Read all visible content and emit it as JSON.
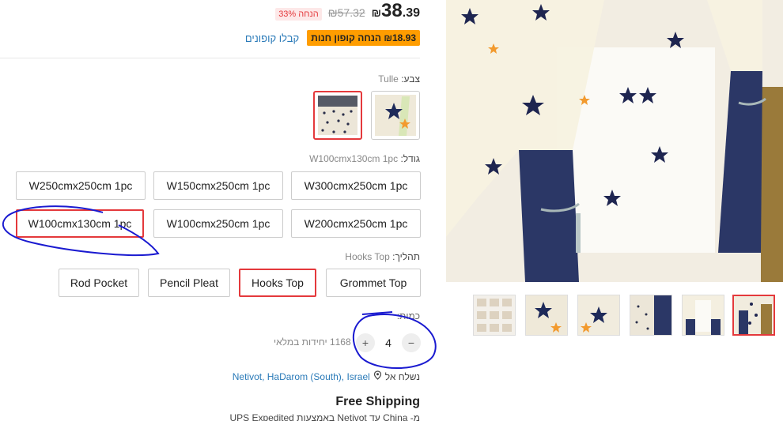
{
  "price": {
    "currency": "₪",
    "integer": "38",
    "decimal": ".39",
    "original": "₪57.32",
    "discount": "הנחה 33%"
  },
  "coupon": {
    "badge": "₪18.93 הנחה קופון חנות",
    "link": "קבלו קופונים"
  },
  "color": {
    "label": "צבע:",
    "value": "Tulle"
  },
  "size": {
    "label": "גודל:",
    "value": "W100cmx130cm 1pc",
    "options": [
      "W300cmx250cm 1pc",
      "W150cmx250cm 1pc",
      "W250cmx250cm 1pc",
      "W200cmx250cm 1pc",
      "W100cmx250cm 1pc",
      "W100cmx130cm 1pc"
    ]
  },
  "process": {
    "label": "תהליך:",
    "value": "Hooks Top",
    "options": [
      "Grommet Top",
      "Hooks Top",
      "Pencil Pleat",
      "Rod Pocket"
    ]
  },
  "quantity": {
    "label": "כמות:",
    "value": "4",
    "minus": "−",
    "plus": "+",
    "available": "1168 יחידות במלאי"
  },
  "shipping": {
    "ship_to_label": "נשלח אל",
    "location": "Netivot, HaDarom (South), Israel",
    "free": "Free Shipping",
    "detail": "מ- China עד Netivot באמצעות UPS Expedited"
  },
  "icons": {
    "location": "location-pin-icon",
    "plus": "plus-icon",
    "minus": "minus-icon"
  },
  "colors": {
    "accent": "#e4393c",
    "coupon": "#ff9d00",
    "link": "#2a7ab8",
    "annotation": "#1a1ad0"
  }
}
